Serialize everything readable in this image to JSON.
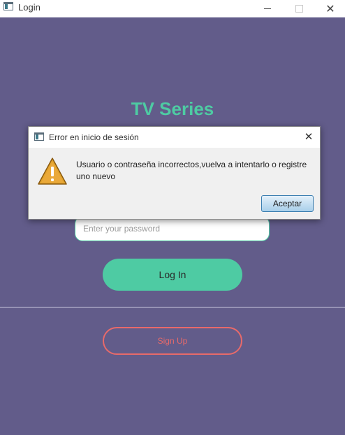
{
  "window": {
    "title": "Login",
    "minimize_icon": "minimize-icon",
    "maximize_icon": "maximize-icon",
    "close_icon": "close-icon"
  },
  "app": {
    "title": "TV Series",
    "password_placeholder": "Enter your password",
    "login_label": "Log In",
    "signup_label": "Sign Up",
    "colors": {
      "background": "#625c8a",
      "accent": "#4ecba3",
      "signup": "#e86a6a"
    }
  },
  "dialog": {
    "title": "Error en inicio de sesión",
    "message": "Usuario o contraseña incorrectos,vuelva a intentarlo o registre uno nuevo",
    "accept_label": "Aceptar",
    "icon": "warning-icon"
  }
}
